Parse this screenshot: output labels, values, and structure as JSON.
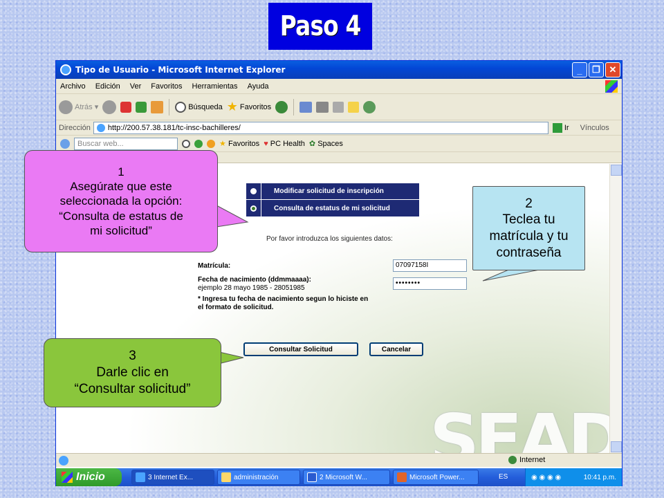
{
  "slide": {
    "title": "Paso 4"
  },
  "window": {
    "title": "Tipo de Usuario - Microsoft Internet Explorer",
    "controls": {
      "minimize": "_",
      "maximize": "❐",
      "close": "✕"
    }
  },
  "menu": [
    "Archivo",
    "Edición",
    "Ver",
    "Favoritos",
    "Herramientas",
    "Ayuda"
  ],
  "toolbar": {
    "back": "Atrás",
    "search": "Búsqueda",
    "favorites": "Favoritos"
  },
  "address": {
    "label": "Dirección",
    "url": "http://200.57.38.181/tc-insc-bachilleres/",
    "go": "Ir",
    "links": "Vínculos"
  },
  "searchbar": {
    "placeholder": "Buscar web...",
    "favorites": "Favoritos",
    "pchealth": "PC Health",
    "spaces": "Spaces"
  },
  "form": {
    "options": [
      {
        "label": "Modificar solicitud de inscripción",
        "selected": false
      },
      {
        "label": "Consulta de estatus de mi solicitud",
        "selected": true
      }
    ],
    "prompt": "Por favor introduzca los siguientes datos:",
    "matricula_label": "Matrícula:",
    "matricula_value": "07097158I",
    "fecha_label": "Fecha de nacimiento (ddmmaaaa):",
    "fecha_example": "ejemplo 28 mayo 1985 - 28051985",
    "password_value": "••••••••",
    "note1": "* Ingresa tu fecha de nacimiento segun lo hiciste en",
    "note2": "el formato de solicitud.",
    "submit": "Consultar Solicitud",
    "cancel": "Cancelar"
  },
  "watermark": "SEAD",
  "status": {
    "zone": "Internet"
  },
  "taskbar": {
    "start": "Inicio",
    "tasks": [
      "3 Internet Ex...",
      "administración",
      "2 Microsoft W...",
      "Microsoft Power..."
    ],
    "lang": "ES",
    "clock": "10:41 p.m."
  },
  "callouts": {
    "c1": {
      "num": "1",
      "line1": "Asegúrate que este",
      "line2": "seleccionada la opción:",
      "line3": "“Consulta de estatus de",
      "line4": "mi solicitud”"
    },
    "c2": {
      "num": "2",
      "line1": "Teclea tu",
      "line2": "matrícula y tu",
      "line3": "contraseña"
    },
    "c3": {
      "num": "3",
      "line1": "Darle clic en",
      "line2": "“Consultar solicitud”"
    }
  }
}
